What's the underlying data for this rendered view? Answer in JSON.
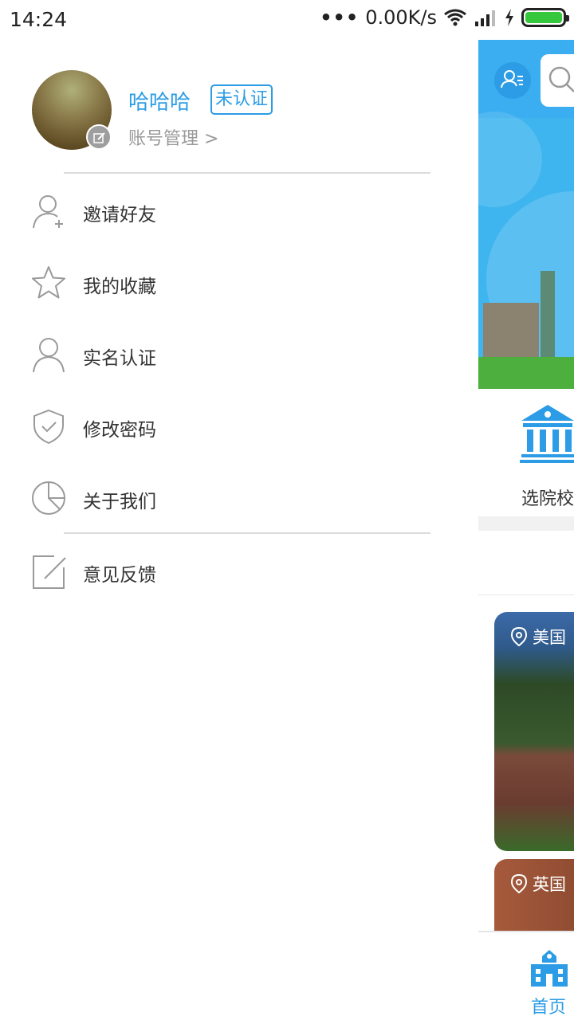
{
  "status_bar": {
    "time": "14:24",
    "network_speed": "0.00K/s",
    "icons": [
      "more-dots-icon",
      "wifi-icon",
      "signal-icon",
      "charging-icon",
      "battery-icon"
    ]
  },
  "drawer": {
    "user_name": "哈哈哈",
    "verify_status": "未认证",
    "account_manage": "账号管理 >",
    "menu": [
      {
        "label": "邀请好友",
        "icon": "add-user-icon"
      },
      {
        "label": "我的收藏",
        "icon": "star-icon"
      },
      {
        "label": "实名认证",
        "icon": "user-icon"
      },
      {
        "label": "修改密码",
        "icon": "shield-icon"
      },
      {
        "label": "关于我们",
        "icon": "pie-chart-icon"
      },
      {
        "label": "意见反馈",
        "icon": "edit-icon"
      }
    ]
  },
  "background_app": {
    "category_label": "选院校",
    "cards": [
      {
        "location": "美国"
      },
      {
        "location": "英国"
      }
    ],
    "tab_home": "首页"
  },
  "colors": {
    "accent": "#2b9ce5",
    "battery": "#35c73c"
  }
}
